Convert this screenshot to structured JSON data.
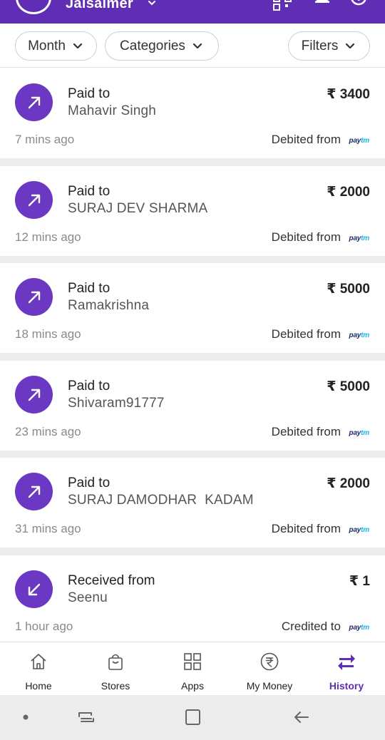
{
  "header": {
    "location": "Jaisalmer",
    "background": "#5f2eb5"
  },
  "filters": [
    {
      "label": "Month"
    },
    {
      "label": "Categories"
    },
    {
      "label": "Filters"
    }
  ],
  "transactions": [
    {
      "type": "Paid to",
      "name": "Mahavir Singh",
      "amount": "₹ 3400",
      "time": "7 mins ago",
      "source_label": "Debited from",
      "direction": "out"
    },
    {
      "type": "Paid to",
      "name": "SURAJ DEV SHARMA",
      "amount": "₹ 2000",
      "time": "12 mins ago",
      "source_label": "Debited from",
      "direction": "out"
    },
    {
      "type": "Paid to",
      "name": "Ramakrishna",
      "amount": "₹ 5000",
      "time": "18 mins ago",
      "source_label": "Debited from",
      "direction": "out"
    },
    {
      "type": "Paid to",
      "name": "Shivaram91777",
      "amount": "₹ 5000",
      "time": "23 mins ago",
      "source_label": "Debited from",
      "direction": "out"
    },
    {
      "type": "Paid to",
      "name": "SURAJ DAMODHAR  KADAM",
      "amount": "₹ 2000",
      "time": "31 mins ago",
      "source_label": "Debited from",
      "direction": "out"
    },
    {
      "type": "Received from",
      "name": "Seenu",
      "amount": "₹ 1",
      "time": "1 hour ago",
      "source_label": "Credited to",
      "direction": "in"
    }
  ],
  "wallet_logo": {
    "part1": "pay",
    "part2": "tm"
  },
  "bottom_nav": [
    {
      "label": "Home",
      "icon": "home-icon"
    },
    {
      "label": "Stores",
      "icon": "shopping-bag-icon"
    },
    {
      "label": "Apps",
      "icon": "apps-grid-icon"
    },
    {
      "label": "My Money",
      "icon": "rupee-icon"
    },
    {
      "label": "History",
      "icon": "swap-arrows-icon",
      "active": true
    }
  ],
  "colors": {
    "brand_purple": "#5f2eb5",
    "icon_purple": "#6a38c2",
    "paytm_navy": "#1c2d6b",
    "paytm_blue": "#20b4e6"
  }
}
